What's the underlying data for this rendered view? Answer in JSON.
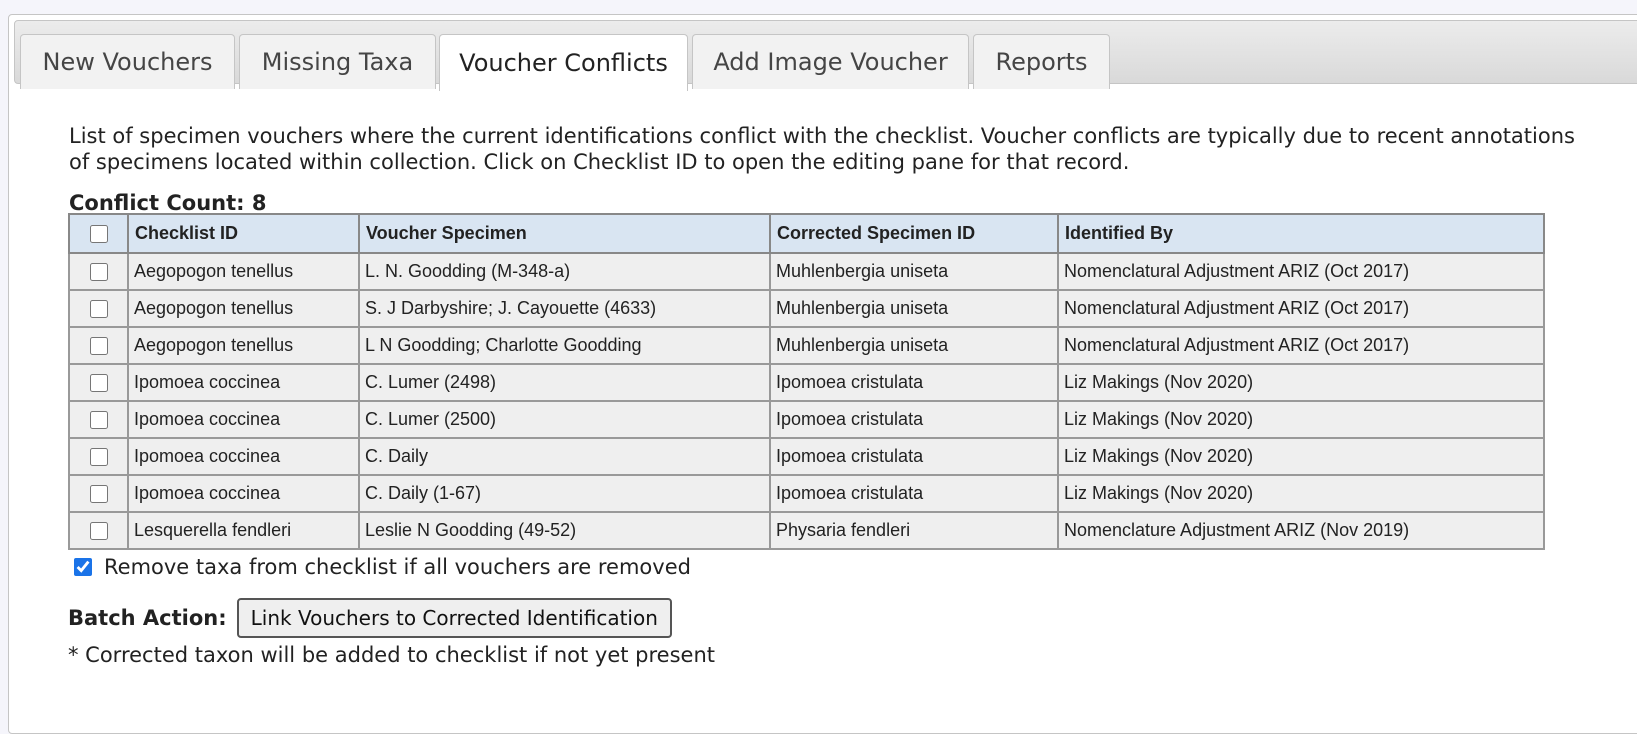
{
  "tabs": [
    {
      "label": "New Vouchers",
      "active": false
    },
    {
      "label": "Missing Taxa",
      "active": false
    },
    {
      "label": "Voucher Conflicts",
      "active": true
    },
    {
      "label": "Add Image Voucher",
      "active": false
    },
    {
      "label": "Reports",
      "active": false
    }
  ],
  "description": "List of specimen vouchers where the current identifications conflict with the checklist. Voucher conflicts are typically due to recent annotations of specimens located within collection. Click on Checklist ID to open the editing pane for that record.",
  "conflict": {
    "label": "Conflict Count:",
    "value": "8"
  },
  "table": {
    "headers": [
      "Checklist ID",
      "Voucher Specimen",
      "Corrected Specimen ID",
      "Identified By"
    ],
    "rows": [
      [
        "Aegopogon tenellus",
        "L. N. Goodding (M-348-a)",
        "Muhlenbergia uniseta",
        "Nomenclatural Adjustment ARIZ (Oct 2017)"
      ],
      [
        "Aegopogon tenellus",
        "S. J Darbyshire; J. Cayouette (4633)",
        "Muhlenbergia uniseta",
        "Nomenclatural Adjustment ARIZ (Oct 2017)"
      ],
      [
        "Aegopogon tenellus",
        "L N Goodding; Charlotte Goodding",
        "Muhlenbergia uniseta",
        "Nomenclatural Adjustment ARIZ (Oct 2017)"
      ],
      [
        "Ipomoea coccinea",
        "C. Lumer (2498)",
        "Ipomoea cristulata",
        "Liz Makings (Nov 2020)"
      ],
      [
        "Ipomoea coccinea",
        "C. Lumer (2500)",
        "Ipomoea cristulata",
        "Liz Makings (Nov 2020)"
      ],
      [
        "Ipomoea coccinea",
        "C. Daily",
        "Ipomoea cristulata",
        "Liz Makings (Nov 2020)"
      ],
      [
        "Ipomoea coccinea",
        "C. Daily (1-67)",
        "Ipomoea cristulata",
        "Liz Makings (Nov 2020)"
      ],
      [
        "Lesquerella fendleri",
        "Leslie N Goodding (49-52)",
        "Physaria fendleri",
        "Nomenclature Adjustment ARIZ (Nov 2019)"
      ]
    ]
  },
  "remove_option": {
    "label": "Remove taxa from checklist if all vouchers are removed",
    "checked": true
  },
  "batch": {
    "label": "Batch Action:",
    "button": "Link Vouchers to Corrected Identification"
  },
  "note": "* Corrected taxon will be added to checklist if not yet present"
}
